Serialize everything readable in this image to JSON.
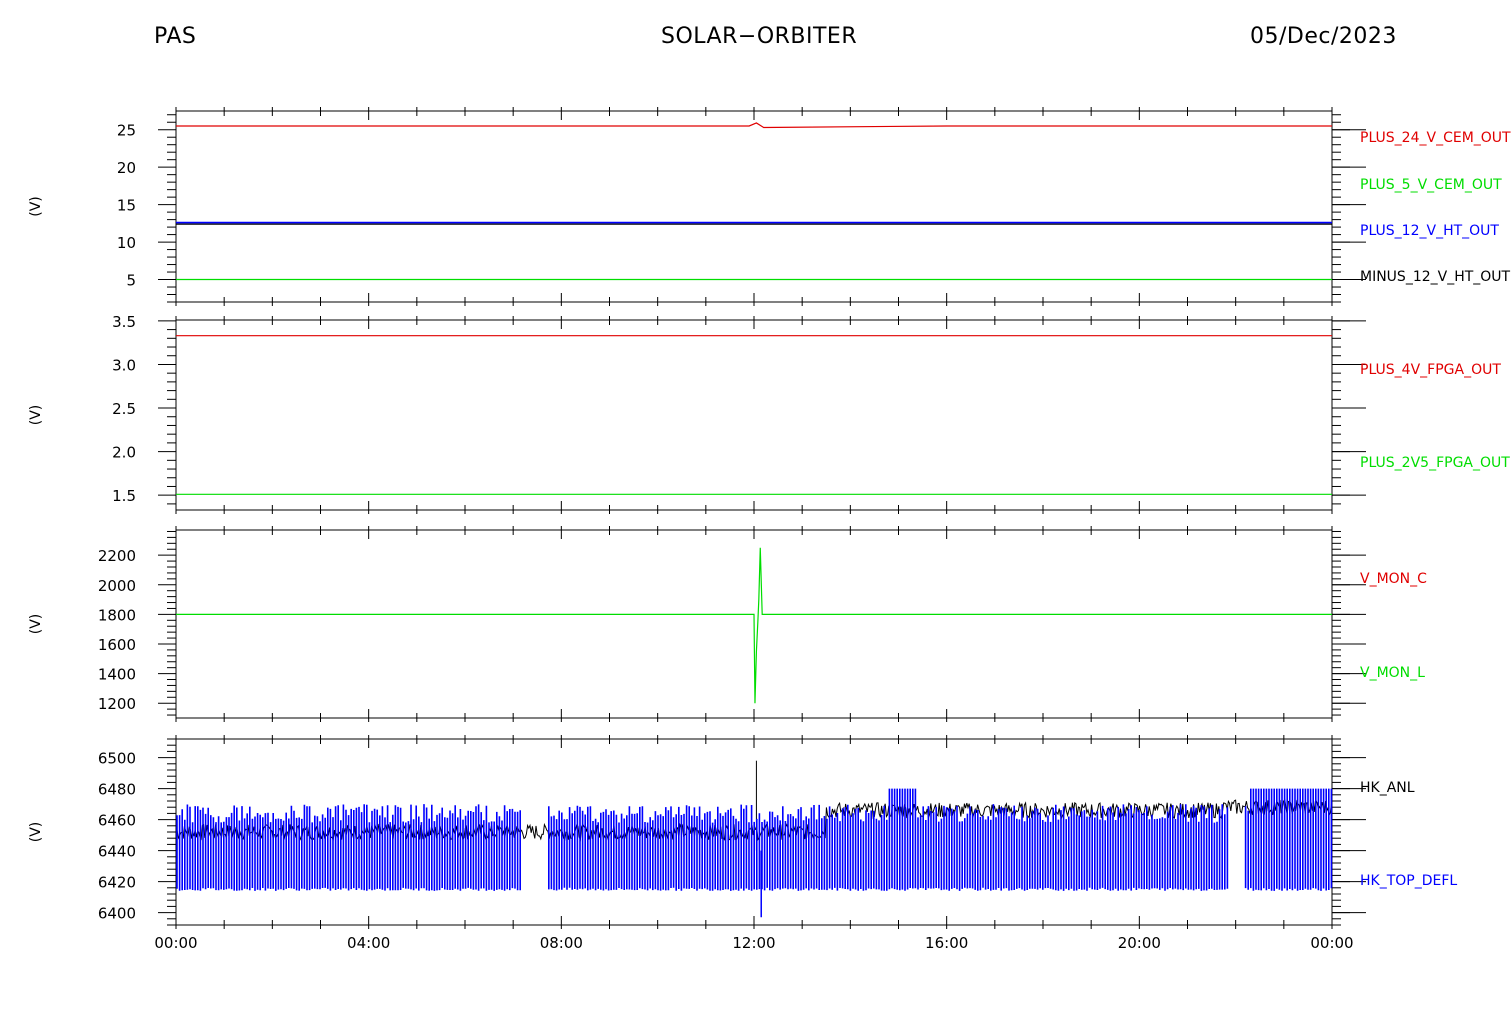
{
  "header": {
    "left": "PAS",
    "center": "SOLAR−ORBITER",
    "right": "05/Dec/2023"
  },
  "colors": {
    "red": "#e00000",
    "green": "#00dd00",
    "blue": "#0000ff",
    "navy": "#000080",
    "black": "#000000"
  },
  "chart_data": [
    {
      "type": "line",
      "ylabel": "(V)",
      "ylim": [
        2,
        27.5
      ],
      "yticks": [
        5,
        10,
        15,
        20,
        25
      ],
      "xlim": [
        0,
        24
      ],
      "series": [
        {
          "name": "PLUS_24_V_CEM_OUT",
          "color": "#e00000",
          "x": [
            0,
            4,
            8,
            11.9,
            12.05,
            12.2,
            16,
            20,
            24
          ],
          "y": [
            25.5,
            25.5,
            25.5,
            25.5,
            25.9,
            25.3,
            25.5,
            25.5,
            25.5
          ]
        },
        {
          "name": "PLUS_5_V_CEM_OUT",
          "color": "#00dd00",
          "x": [
            0,
            24
          ],
          "y": [
            5,
            5
          ]
        },
        {
          "name": "PLUS_12_V_HT_OUT",
          "color": "#0000ff",
          "x": [
            0,
            24
          ],
          "y": [
            12.6,
            12.6
          ]
        },
        {
          "name": "MINUS_12_V_HT_OUT",
          "color": "#000000",
          "x": [
            0,
            24
          ],
          "y": [
            12.4,
            12.4
          ]
        }
      ],
      "legend_labels": [
        "PLUS_24_V_CEM_OUT",
        "PLUS_5_V_CEM_OUT",
        "PLUS_12_V_HT_OUT",
        "MINUS_12_V_HT_OUT"
      ],
      "legend_colors": [
        "#e00000",
        "#00dd00",
        "#0000ff",
        "#000000"
      ]
    },
    {
      "type": "line",
      "ylabel": "(V)",
      "ylim": [
        1.33,
        3.51
      ],
      "yticks": [
        1.5,
        2.0,
        2.5,
        3.0,
        3.5
      ],
      "ytick_labels": [
        "1.5",
        "2.0",
        "2.5",
        "3.0",
        "3.5"
      ],
      "xlim": [
        0,
        24
      ],
      "series": [
        {
          "name": "PLUS_4V_FPGA_OUT",
          "color": "#e00000",
          "x": [
            0,
            24
          ],
          "y": [
            3.33,
            3.33
          ]
        },
        {
          "name": "PLUS_2V5_FPGA_OUT",
          "color": "#00dd00",
          "x": [
            0,
            24
          ],
          "y": [
            1.51,
            1.51
          ]
        }
      ],
      "legend_labels": [
        "PLUS_4V_FPGA_OUT",
        "PLUS_2V5_FPGA_OUT"
      ],
      "legend_colors": [
        "#e00000",
        "#00dd00"
      ]
    },
    {
      "type": "line",
      "ylabel": "(V)",
      "ylim": [
        1100,
        2370
      ],
      "yticks": [
        1200,
        1400,
        1600,
        1800,
        2000,
        2200
      ],
      "xlim": [
        0,
        24
      ],
      "series": [
        {
          "name": "V_MON_L",
          "color": "#00dd00",
          "x": [
            0,
            12.0,
            12.02,
            12.05,
            12.08,
            12.1,
            12.13,
            12.17,
            12.2,
            24
          ],
          "y": [
            1800,
            1800,
            1200,
            1550,
            1750,
            1900,
            2250,
            1800,
            1800,
            1800
          ]
        }
      ],
      "legend_labels": [
        "V_MON_C",
        "V_MON_L"
      ],
      "legend_colors": [
        "#e00000",
        "#00dd00"
      ]
    },
    {
      "type": "line",
      "ylabel": "(V)",
      "ylim": [
        6392,
        6512
      ],
      "yticks": [
        6400,
        6420,
        6440,
        6460,
        6480,
        6500
      ],
      "xlim": [
        0,
        24
      ],
      "series": [
        {
          "name": "HK_ANL",
          "color": "#000000",
          "baseline": 6452,
          "band": 10,
          "spike_x": 12.05,
          "spike_y": 6498
        },
        {
          "name": "HK_TOP_DEFL",
          "color": "#0000ff",
          "low": 6414,
          "high": 6470,
          "gaps": [
            [
              7.15,
              7.7
            ],
            [
              21.85,
              22.2
            ]
          ],
          "spike_y": 6397
        }
      ],
      "legend_labels": [
        "HK_ANL",
        "HK_TOP_DEFL"
      ],
      "legend_colors": [
        "#000000",
        "#0000ff"
      ]
    }
  ],
  "xaxis": {
    "tick_labels": [
      "00:00",
      "04:00",
      "08:00",
      "12:00",
      "16:00",
      "20:00",
      "00:00"
    ]
  }
}
